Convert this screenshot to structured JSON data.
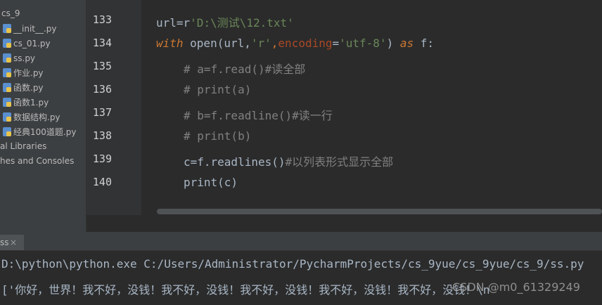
{
  "project_tree": {
    "items": [
      {
        "label": "cs_9",
        "kind": "folder"
      },
      {
        "label": "__init__.py",
        "kind": "py"
      },
      {
        "label": "cs_01.py",
        "kind": "py"
      },
      {
        "label": "ss.py",
        "kind": "py"
      },
      {
        "label": "作业.py",
        "kind": "py"
      },
      {
        "label": "函数.py",
        "kind": "py"
      },
      {
        "label": "函数1.py",
        "kind": "py"
      },
      {
        "label": "数据结构.py",
        "kind": "py"
      },
      {
        "label": "经典100道题.py",
        "kind": "py"
      },
      {
        "label": "al Libraries",
        "kind": "lib"
      },
      {
        "label": "hes and Consoles",
        "kind": "lib"
      }
    ]
  },
  "editor": {
    "line_numbers": [
      "133",
      "134",
      "135",
      "136",
      "137",
      "138",
      "139",
      "140"
    ],
    "lines": {
      "l133": {
        "a": "url=r",
        "b": "'D:\\测试\\12.txt'"
      },
      "l134": {
        "kw1": "with",
        "fn": " open",
        "p1": "(url,",
        "s1": "'r'",
        "c": ",",
        "param": "encoding",
        "eq": "=",
        "s2": "'utf-8'",
        "p2": ") ",
        "kw2": "as",
        "tail": " f:"
      },
      "l135": {
        "cmt": "# a=f.read()#读全部"
      },
      "l136": {
        "cmt": "# print(a)"
      },
      "l137": {
        "cmt": "# b=f.readline()#读一行"
      },
      "l138": {
        "cmt": "# print(b)"
      },
      "l139": {
        "code": "c=f.readlines()",
        "cmt": "#以列表形式显示全部"
      },
      "l140": {
        "code": "print(c)"
      }
    }
  },
  "run_panel": {
    "tab_label": "ss",
    "close": "×",
    "console": {
      "command": "D:\\python\\python.exe C:/Users/Administrator/PycharmProjects/cs_9yue/cs_9yue/cs_9/ss.py",
      "output": "['你好，世界！我不好，没钱！我不好，没钱！我不好，没钱！我不好，没钱！我不好，没钱！\\n"
    }
  },
  "watermark": "CSDN @m0_61329249",
  "colors": {
    "keyword": "#cc7832",
    "string": "#6a8759",
    "comment": "#808080",
    "text": "#a9b7c6"
  }
}
